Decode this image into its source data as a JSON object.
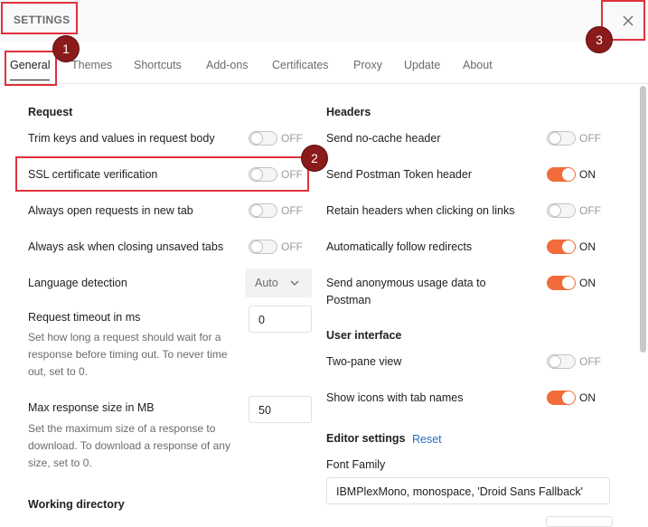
{
  "title": "SETTINGS",
  "tabs": [
    "General",
    "Themes",
    "Shortcuts",
    "Add-ons",
    "Certificates",
    "Proxy",
    "Update",
    "About"
  ],
  "annotations": {
    "badge1": "1",
    "badge2": "2",
    "badge3": "3"
  },
  "request": {
    "heading": "Request",
    "trim": {
      "label": "Trim keys and values in request body",
      "state": "OFF"
    },
    "ssl": {
      "label": "SSL certificate verification",
      "state": "OFF"
    },
    "newtab": {
      "label": "Always open requests in new tab",
      "state": "OFF"
    },
    "askclose": {
      "label": "Always ask when closing unsaved tabs",
      "state": "OFF"
    },
    "language": {
      "label": "Language detection",
      "value": "Auto"
    },
    "timeout": {
      "label": "Request timeout in ms",
      "description": "Set how long a request should wait for a response before timing out. To never time out, set to 0.",
      "value": "0"
    },
    "maxsize": {
      "label": "Max response size in MB",
      "description": "Set the maximum size of a response to download. To download a response of any size, set to 0.",
      "value": "50"
    },
    "workdir_heading": "Working directory"
  },
  "headers": {
    "heading": "Headers",
    "nocache": {
      "label": "Send no-cache header",
      "state": "OFF"
    },
    "token": {
      "label": "Send Postman Token header",
      "state": "ON"
    },
    "retain": {
      "label": "Retain headers when clicking on links",
      "state": "OFF"
    },
    "redirects": {
      "label": "Automatically follow redirects",
      "state": "ON"
    },
    "anon": {
      "label": "Send anonymous usage data to Postman",
      "state": "ON"
    }
  },
  "ui": {
    "heading": "User interface",
    "twopane": {
      "label": "Two-pane view",
      "state": "OFF"
    },
    "icons": {
      "label": "Show icons with tab names",
      "state": "ON"
    }
  },
  "editor": {
    "heading": "Editor settings",
    "reset": "Reset",
    "font_label": "Font Family",
    "font_value": "IBMPlexMono, monospace, 'Droid Sans Fallback'"
  },
  "colors": {
    "accent": "#f26b3a",
    "annotation": "#e0313d",
    "badge": "#8b1a1a",
    "link": "#1f6fc5"
  }
}
